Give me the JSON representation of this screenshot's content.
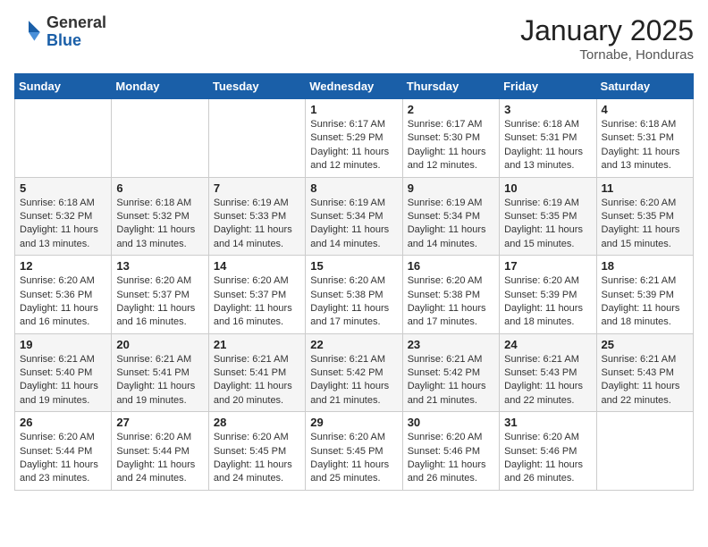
{
  "header": {
    "logo_general": "General",
    "logo_blue": "Blue",
    "month_title": "January 2025",
    "location": "Tornabe, Honduras"
  },
  "days_of_week": [
    "Sunday",
    "Monday",
    "Tuesday",
    "Wednesday",
    "Thursday",
    "Friday",
    "Saturday"
  ],
  "weeks": [
    [
      {
        "day": "",
        "info": ""
      },
      {
        "day": "",
        "info": ""
      },
      {
        "day": "",
        "info": ""
      },
      {
        "day": "1",
        "info": "Sunrise: 6:17 AM\nSunset: 5:29 PM\nDaylight: 11 hours and 12 minutes."
      },
      {
        "day": "2",
        "info": "Sunrise: 6:17 AM\nSunset: 5:30 PM\nDaylight: 11 hours and 12 minutes."
      },
      {
        "day": "3",
        "info": "Sunrise: 6:18 AM\nSunset: 5:31 PM\nDaylight: 11 hours and 13 minutes."
      },
      {
        "day": "4",
        "info": "Sunrise: 6:18 AM\nSunset: 5:31 PM\nDaylight: 11 hours and 13 minutes."
      }
    ],
    [
      {
        "day": "5",
        "info": "Sunrise: 6:18 AM\nSunset: 5:32 PM\nDaylight: 11 hours and 13 minutes."
      },
      {
        "day": "6",
        "info": "Sunrise: 6:18 AM\nSunset: 5:32 PM\nDaylight: 11 hours and 13 minutes."
      },
      {
        "day": "7",
        "info": "Sunrise: 6:19 AM\nSunset: 5:33 PM\nDaylight: 11 hours and 14 minutes."
      },
      {
        "day": "8",
        "info": "Sunrise: 6:19 AM\nSunset: 5:34 PM\nDaylight: 11 hours and 14 minutes."
      },
      {
        "day": "9",
        "info": "Sunrise: 6:19 AM\nSunset: 5:34 PM\nDaylight: 11 hours and 14 minutes."
      },
      {
        "day": "10",
        "info": "Sunrise: 6:19 AM\nSunset: 5:35 PM\nDaylight: 11 hours and 15 minutes."
      },
      {
        "day": "11",
        "info": "Sunrise: 6:20 AM\nSunset: 5:35 PM\nDaylight: 11 hours and 15 minutes."
      }
    ],
    [
      {
        "day": "12",
        "info": "Sunrise: 6:20 AM\nSunset: 5:36 PM\nDaylight: 11 hours and 16 minutes."
      },
      {
        "day": "13",
        "info": "Sunrise: 6:20 AM\nSunset: 5:37 PM\nDaylight: 11 hours and 16 minutes."
      },
      {
        "day": "14",
        "info": "Sunrise: 6:20 AM\nSunset: 5:37 PM\nDaylight: 11 hours and 16 minutes."
      },
      {
        "day": "15",
        "info": "Sunrise: 6:20 AM\nSunset: 5:38 PM\nDaylight: 11 hours and 17 minutes."
      },
      {
        "day": "16",
        "info": "Sunrise: 6:20 AM\nSunset: 5:38 PM\nDaylight: 11 hours and 17 minutes."
      },
      {
        "day": "17",
        "info": "Sunrise: 6:20 AM\nSunset: 5:39 PM\nDaylight: 11 hours and 18 minutes."
      },
      {
        "day": "18",
        "info": "Sunrise: 6:21 AM\nSunset: 5:39 PM\nDaylight: 11 hours and 18 minutes."
      }
    ],
    [
      {
        "day": "19",
        "info": "Sunrise: 6:21 AM\nSunset: 5:40 PM\nDaylight: 11 hours and 19 minutes."
      },
      {
        "day": "20",
        "info": "Sunrise: 6:21 AM\nSunset: 5:41 PM\nDaylight: 11 hours and 19 minutes."
      },
      {
        "day": "21",
        "info": "Sunrise: 6:21 AM\nSunset: 5:41 PM\nDaylight: 11 hours and 20 minutes."
      },
      {
        "day": "22",
        "info": "Sunrise: 6:21 AM\nSunset: 5:42 PM\nDaylight: 11 hours and 21 minutes."
      },
      {
        "day": "23",
        "info": "Sunrise: 6:21 AM\nSunset: 5:42 PM\nDaylight: 11 hours and 21 minutes."
      },
      {
        "day": "24",
        "info": "Sunrise: 6:21 AM\nSunset: 5:43 PM\nDaylight: 11 hours and 22 minutes."
      },
      {
        "day": "25",
        "info": "Sunrise: 6:21 AM\nSunset: 5:43 PM\nDaylight: 11 hours and 22 minutes."
      }
    ],
    [
      {
        "day": "26",
        "info": "Sunrise: 6:20 AM\nSunset: 5:44 PM\nDaylight: 11 hours and 23 minutes."
      },
      {
        "day": "27",
        "info": "Sunrise: 6:20 AM\nSunset: 5:44 PM\nDaylight: 11 hours and 24 minutes."
      },
      {
        "day": "28",
        "info": "Sunrise: 6:20 AM\nSunset: 5:45 PM\nDaylight: 11 hours and 24 minutes."
      },
      {
        "day": "29",
        "info": "Sunrise: 6:20 AM\nSunset: 5:45 PM\nDaylight: 11 hours and 25 minutes."
      },
      {
        "day": "30",
        "info": "Sunrise: 6:20 AM\nSunset: 5:46 PM\nDaylight: 11 hours and 26 minutes."
      },
      {
        "day": "31",
        "info": "Sunrise: 6:20 AM\nSunset: 5:46 PM\nDaylight: 11 hours and 26 minutes."
      },
      {
        "day": "",
        "info": ""
      }
    ]
  ]
}
